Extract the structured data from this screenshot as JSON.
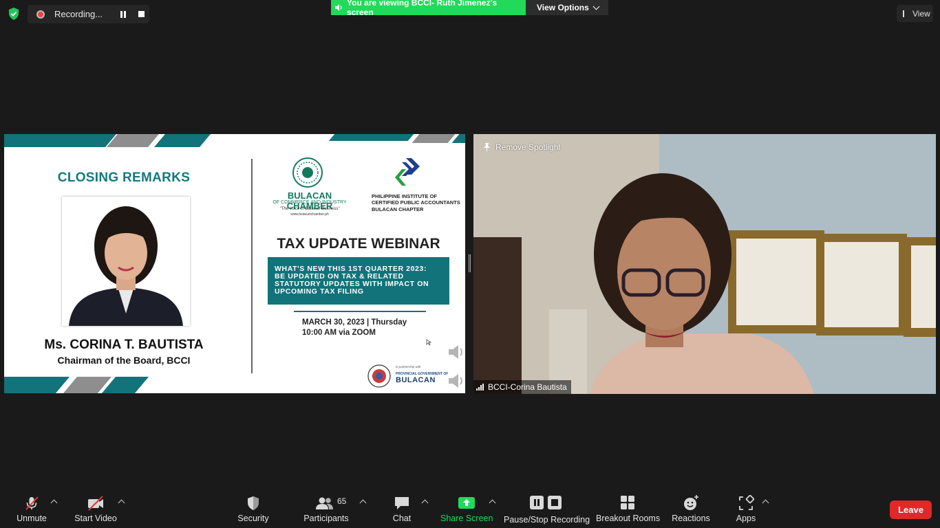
{
  "top_bar": {
    "recording_label": "Recording...",
    "viewing_banner": "You are viewing BCCI- Ruth Jimenez's screen",
    "view_options_label": "View Options",
    "view_label": "View"
  },
  "shared_screen": {
    "closing_heading": "CLOSING REMARKS",
    "speaker_name": "Ms. CORINA T. BAUTISTA",
    "speaker_title": "Chairman of the Board, BCCI",
    "bcci_name": "BULACAN CHAMBER",
    "bcci_sub": "OF COMMERCE AND INDUSTRY",
    "bcci_tagline": "\"The Voice of Bulacan Business\"",
    "bcci_url": "www.bulacanchamber.ph",
    "picpa_line1": "PHILIPPINE INSTITUTE OF",
    "picpa_line2": "CERTIFIED PUBLIC ACCOUNTANTS",
    "picpa_line3": "BULACAN CHAPTER",
    "webinar_title": "TAX UPDATE WEBINAR",
    "webinar_box_line1": "WHAT'S NEW THIS 1ST QUARTER 2023:",
    "webinar_box_line2": "BE UPDATED ON TAX & RELATED",
    "webinar_box_line3": "STATUTORY UPDATES WITH IMPACT ON",
    "webinar_box_line4": "UPCOMING TAX FILING",
    "date_line": "MARCH 30, 2023 | Thursday",
    "time_line": "10:00 AM via ZOOM",
    "partner_text": "in partnership with",
    "province_text": "PROVINCIAL GOVERNMENT OF",
    "province_name": "BULACAN"
  },
  "video_tile": {
    "remove_spotlight_label": "Remove Spotlight",
    "participant_name": "BCCI-Corina Bautista"
  },
  "toolbar": {
    "unmute_label": "Unmute",
    "start_video_label": "Start Video",
    "security_label": "Security",
    "participants_label": "Participants",
    "participants_count": "65",
    "chat_label": "Chat",
    "share_screen_label": "Share Screen",
    "pause_stop_label": "Pause/Stop Recording",
    "breakout_label": "Breakout Rooms",
    "reactions_label": "Reactions",
    "apps_label": "Apps",
    "leave_label": "Leave"
  },
  "colors": {
    "share_green": "#23d959",
    "leave_red": "#e02828",
    "slide_teal": "#12737a"
  },
  "icons": [
    "shield-check-icon",
    "record-icon",
    "pause-icon",
    "stop-icon",
    "speaker-icon",
    "chevron-down-icon",
    "view-icon",
    "pin-icon",
    "signal-icon",
    "mic-muted-icon",
    "video-off-icon",
    "security-shield-icon",
    "participants-icon",
    "chat-icon",
    "share-screen-icon",
    "pause-stop-icon",
    "breakout-icon",
    "reactions-icon",
    "apps-icon"
  ]
}
